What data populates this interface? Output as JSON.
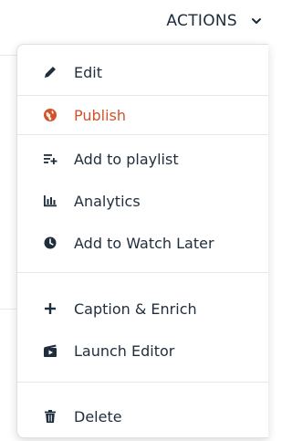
{
  "header": {
    "actions_label": "ACTIONS",
    "chevron_icon": "chevron-down-icon"
  },
  "menu": {
    "items": [
      {
        "label": "Edit",
        "icon": "pencil-icon"
      },
      {
        "label": "Publish",
        "icon": "globe-icon",
        "color": "#d2522a"
      },
      {
        "label": "Add to playlist",
        "icon": "add-to-playlist-icon"
      },
      {
        "label": "Analytics",
        "icon": "bar-chart-icon"
      },
      {
        "label": "Add to Watch Later",
        "icon": "clock-icon"
      },
      {
        "label": "Caption & Enrich",
        "icon": "plus-icon"
      },
      {
        "label": "Launch Editor",
        "icon": "video-editor-icon"
      },
      {
        "label": "Delete",
        "icon": "trash-icon"
      }
    ]
  },
  "colors": {
    "accent": "#d2522a",
    "text": "#1f2d3d"
  }
}
